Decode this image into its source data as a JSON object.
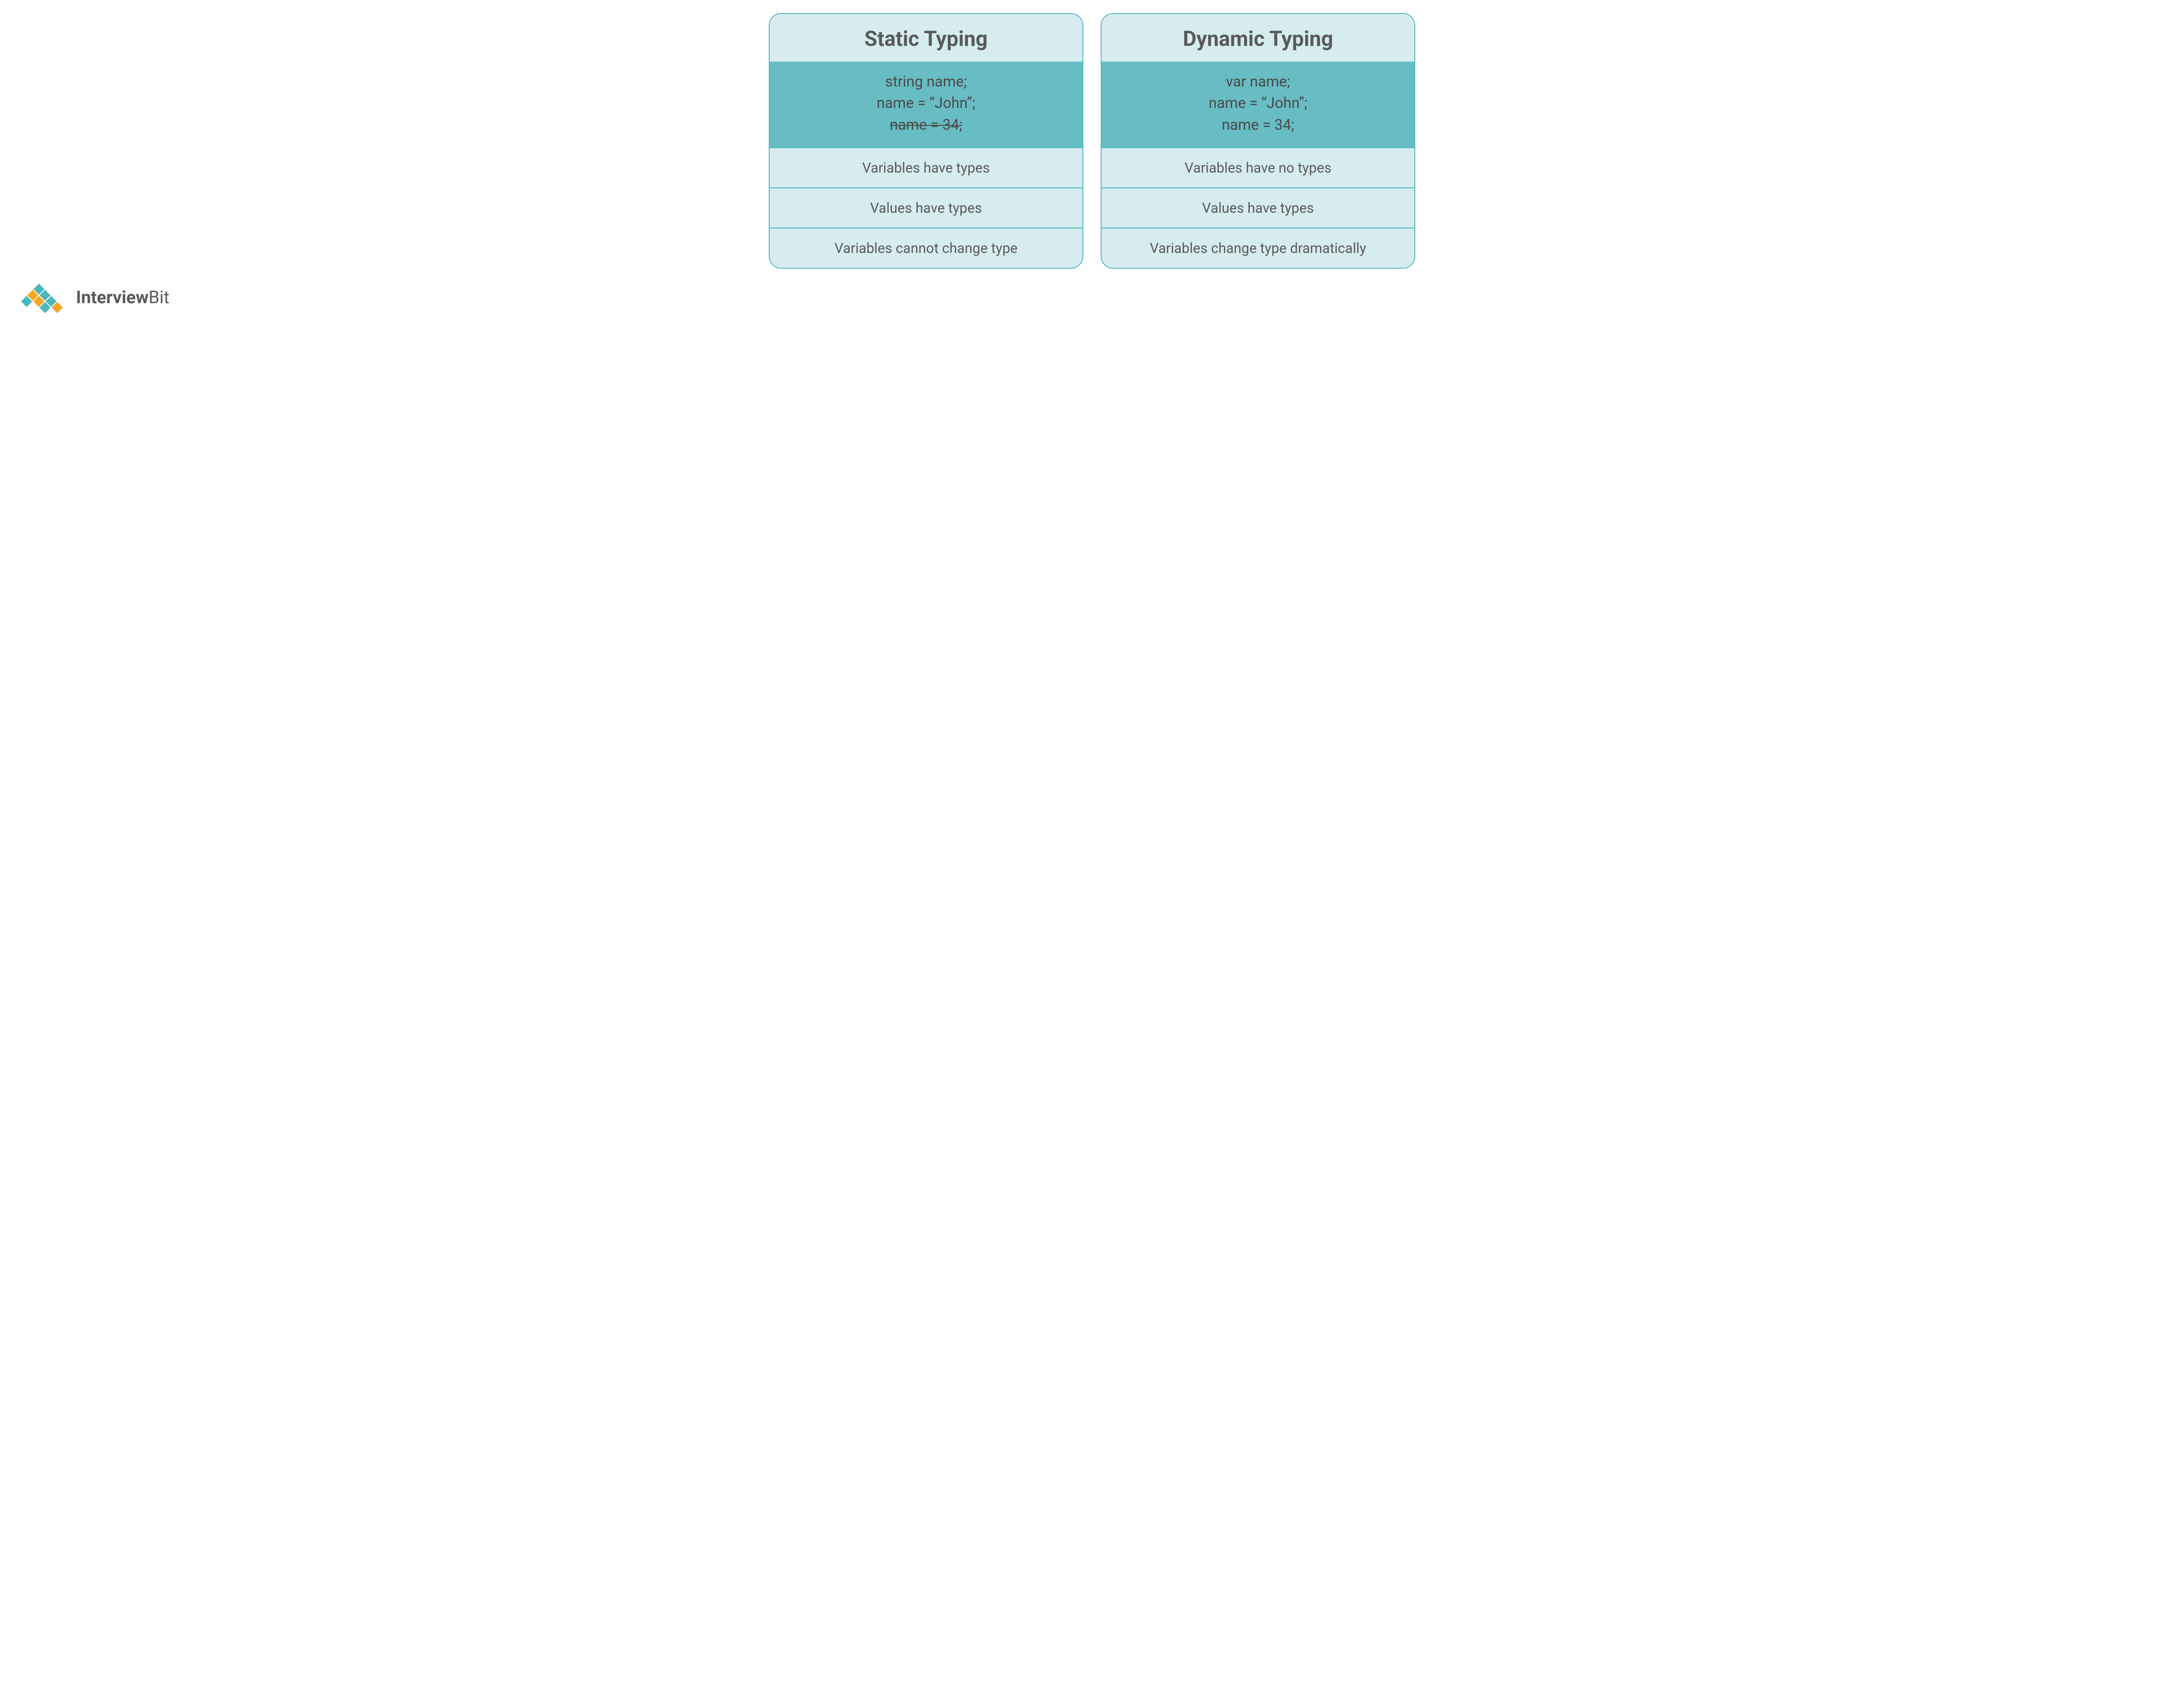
{
  "cards": {
    "static": {
      "title": "Static Typing",
      "code": {
        "line1": "string name;",
        "line2": "name = “John”;",
        "line3": "name = 34;"
      },
      "features": {
        "f1": "Variables have types",
        "f2": "Values have types",
        "f3": "Variables cannot change type"
      }
    },
    "dynamic": {
      "title": "Dynamic Typing",
      "code": {
        "line1": "var name;",
        "line2": "name = “John”;",
        "line3": "name = 34;"
      },
      "features": {
        "f1": "Variables have no types",
        "f2": "Values have types",
        "f3": "Variables change type dramatically"
      }
    }
  },
  "branding": {
    "name_bold": "Interview",
    "name_light": "Bit"
  }
}
